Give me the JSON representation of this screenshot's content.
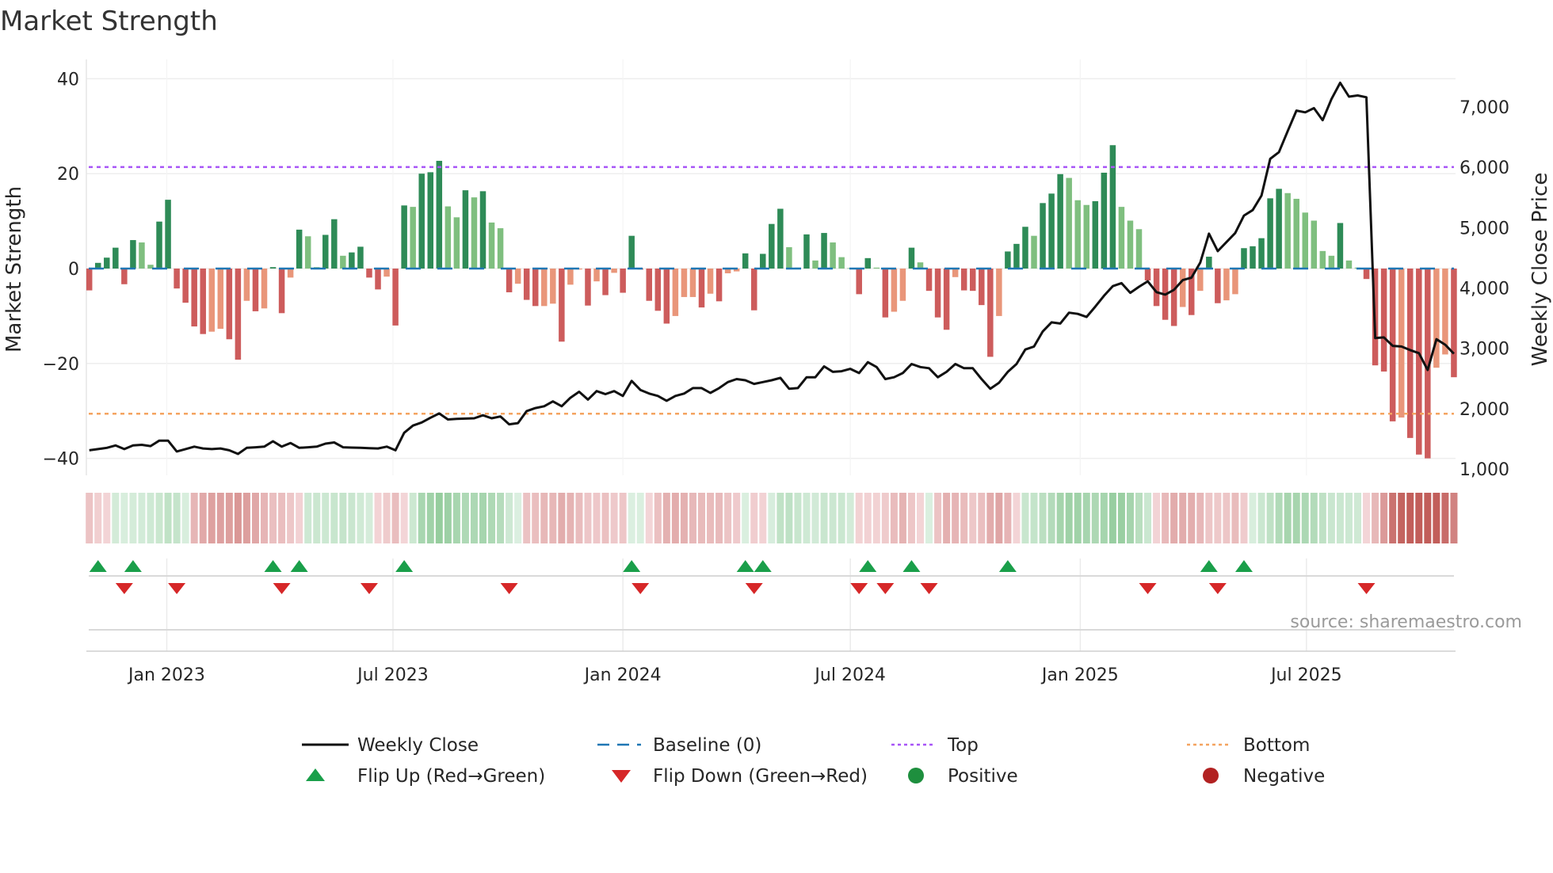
{
  "title": "Market Strength",
  "source": "source: sharemaestro.com",
  "colors": {
    "pos_strong": "#2e8b57",
    "pos_weak": "#7fbf7f",
    "neg_strong": "#cd5c5c",
    "neg_weak": "#e9967a",
    "baseline": "#1f77b4",
    "top": "#a855f7",
    "bottom": "#f4a460",
    "price": "#111111",
    "flip_up": "#1a9f4a",
    "flip_down": "#d62728",
    "positive": "#1e8f3e",
    "negative": "#b22222"
  },
  "legend": {
    "weekly_close": "Weekly Close",
    "baseline": "Baseline (0)",
    "top": "Top",
    "bottom": "Bottom",
    "flip_up": "Flip Up (Red→Green)",
    "flip_down": "Flip Down (Green→Red)",
    "positive": "Positive",
    "negative": "Negative"
  },
  "chart_data": {
    "type": "bar",
    "title": "Market Strength",
    "ylabel": "Market Strength",
    "y2label": "Weekly Close Price",
    "ylim": [
      -44,
      44
    ],
    "y2lim": [
      770,
      7790
    ],
    "start_week": "2022-10-31",
    "interval": "weekly",
    "y_ticks": [
      "40",
      "20",
      "0",
      "−20",
      "−40"
    ],
    "y_tick_values": [
      40,
      20,
      0,
      -20,
      -40
    ],
    "y2_ticks": [
      "7,000",
      "6,000",
      "5,000",
      "4,000",
      "3,000",
      "2,000",
      "1,000"
    ],
    "y2_tick_values": [
      7000,
      6000,
      5000,
      4000,
      3000,
      2000,
      1000
    ],
    "x_ticks": [
      "Jan 2023",
      "Jul 2023",
      "Jan 2024",
      "Jul 2024",
      "Jan 2025",
      "Jul 2025"
    ],
    "x_tick_dates": [
      "2023-01-01",
      "2023-07-01",
      "2024-01-01",
      "2024-07-01",
      "2025-01-01",
      "2025-07-01"
    ],
    "top_level": 21.4,
    "bottom_level": -30.6,
    "baseline": 0,
    "strength": [
      -4.6,
      1.2,
      2.3,
      4.4,
      -3.3,
      6.0,
      5.5,
      0.8,
      9.9,
      14.5,
      -4.2,
      -7.2,
      -12.2,
      -13.8,
      -13.3,
      -12.7,
      -14.9,
      -19.2,
      -6.8,
      -9.0,
      -8.4,
      0.3,
      -9.4,
      -1.9,
      8.2,
      6.8,
      0.3,
      7.1,
      10.4,
      2.7,
      3.4,
      4.6,
      -1.9,
      -4.4,
      -1.7,
      -12.0,
      13.3,
      13.0,
      20.0,
      20.3,
      22.7,
      13.1,
      10.8,
      16.5,
      15.0,
      16.3,
      9.7,
      8.5,
      -5.0,
      -3.2,
      -6.6,
      -7.9,
      -7.9,
      -7.4,
      -15.4,
      -3.4,
      -0.2,
      -7.8,
      -2.7,
      -5.6,
      -0.9,
      -5.1,
      6.9,
      -0.2,
      -6.8,
      -8.9,
      -11.6,
      -10.0,
      -6.0,
      -6.0,
      -8.2,
      -5.3,
      -6.9,
      -1.0,
      -0.6,
      3.2,
      -8.8,
      3.1,
      9.4,
      12.6,
      4.5,
      0.2,
      7.2,
      1.7,
      7.5,
      5.5,
      2.4,
      0.1,
      -5.4,
      2.2,
      0.2,
      -10.3,
      -9.1,
      -6.8,
      4.4,
      1.3,
      -4.7,
      -10.3,
      -12.9,
      -1.8,
      -4.6,
      -4.7,
      -7.7,
      -18.6,
      -10.0,
      3.6,
      5.2,
      8.8,
      6.9,
      13.8,
      15.8,
      19.9,
      19.1,
      14.4,
      13.4,
      14.2,
      20.2,
      26.0,
      13.0,
      10.1,
      8.3,
      -2.5,
      -7.9,
      -10.8,
      -12.1,
      -8.1,
      -9.8,
      -4.7,
      2.5,
      -7.3,
      -6.7,
      -5.4,
      4.3,
      4.7,
      6.4,
      14.8,
      16.8,
      15.9,
      14.7,
      11.8,
      10.1,
      3.7,
      2.7,
      9.6,
      1.7,
      0.2,
      -2.2,
      -20.4,
      -21.7,
      -32.2,
      -31.4,
      -35.7,
      -39.2,
      -40.0,
      -20.9,
      -18.1,
      -22.9
    ],
    "weekly_close": [
      1310,
      1330,
      1350,
      1390,
      1330,
      1390,
      1400,
      1380,
      1470,
      1470,
      1290,
      1330,
      1370,
      1340,
      1330,
      1340,
      1310,
      1250,
      1350,
      1360,
      1370,
      1460,
      1370,
      1430,
      1350,
      1360,
      1370,
      1420,
      1440,
      1360,
      1355,
      1350,
      1345,
      1340,
      1370,
      1310,
      1600,
      1720,
      1770,
      1850,
      1920,
      1820,
      1830,
      1835,
      1840,
      1890,
      1840,
      1870,
      1740,
      1760,
      1960,
      2010,
      2040,
      2120,
      2040,
      2180,
      2280,
      2150,
      2290,
      2240,
      2290,
      2210,
      2460,
      2310,
      2250,
      2210,
      2130,
      2210,
      2250,
      2340,
      2340,
      2260,
      2340,
      2440,
      2490,
      2470,
      2410,
      2440,
      2470,
      2510,
      2330,
      2340,
      2520,
      2520,
      2700,
      2610,
      2620,
      2660,
      2590,
      2770,
      2690,
      2490,
      2520,
      2590,
      2740,
      2690,
      2670,
      2520,
      2610,
      2740,
      2670,
      2670,
      2490,
      2330,
      2430,
      2610,
      2740,
      2980,
      3030,
      3280,
      3430,
      3410,
      3590,
      3570,
      3520,
      3690,
      3870,
      4030,
      4080,
      3920,
      4020,
      4110,
      3930,
      3890,
      3970,
      4130,
      4170,
      4420,
      4900,
      4610,
      4760,
      4910,
      5200,
      5290,
      5530,
      6140,
      6250,
      6600,
      6940,
      6910,
      6980,
      6780,
      7130,
      7400,
      7170,
      7190,
      7160,
      3170,
      3180,
      3040,
      3030,
      2970,
      2920,
      2640,
      3150,
      3060,
      2910
    ],
    "flip_up_weeks": [
      1,
      5,
      21,
      24,
      36,
      62,
      75,
      77,
      89,
      94,
      105,
      128,
      132
    ],
    "flip_down_weeks": [
      4,
      10,
      22,
      32,
      48,
      63,
      76,
      88,
      91,
      96,
      121,
      129,
      146
    ],
    "legend_position": "bottom"
  }
}
